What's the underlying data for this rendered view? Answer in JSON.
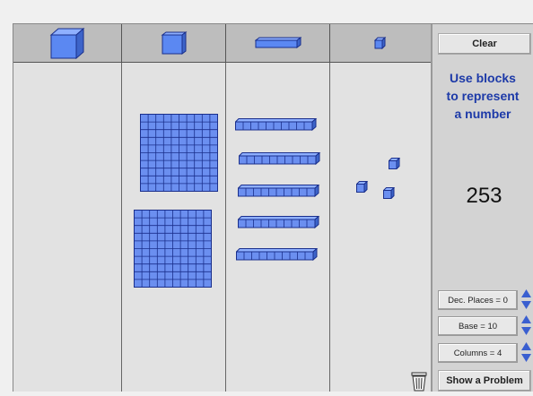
{
  "toolbar": {
    "columns": [
      {
        "name": "hundreds-cube",
        "icon": "large-cube-icon"
      },
      {
        "name": "flat",
        "icon": "flat-icon"
      },
      {
        "name": "long",
        "icon": "rod-icon"
      },
      {
        "name": "unit",
        "icon": "unit-cube-icon"
      }
    ]
  },
  "side": {
    "clear_label": "Clear",
    "prompt_lines": [
      "Use blocks",
      "to represent",
      "a number"
    ],
    "number": "253",
    "dec_places_label": "Dec. Places = 0",
    "base_label": "Base = 10",
    "columns_label": "Columns = 4",
    "show_problem_label": "Show a Problem"
  },
  "blocks": {
    "flats": 2,
    "longs": 5,
    "units": 3
  },
  "colors": {
    "block_fill": "#6b8ff0",
    "block_grid": "#1a2f8c",
    "prompt_text": "#1d3aa8"
  }
}
